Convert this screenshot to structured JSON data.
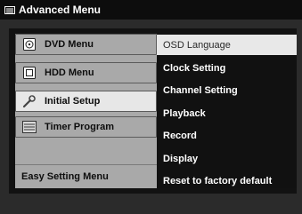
{
  "window": {
    "title": "Advanced Menu"
  },
  "left_menu": {
    "items": [
      {
        "label": "DVD Menu",
        "icon": "disc-icon"
      },
      {
        "label": "HDD Menu",
        "icon": "hdd-icon"
      },
      {
        "label": "Initial Setup",
        "icon": "wrench-icon"
      },
      {
        "label": "Timer Program",
        "icon": "list-icon"
      }
    ],
    "selected_index": 2,
    "easy_setting_label": "Easy Setting Menu"
  },
  "right_menu": {
    "items": [
      {
        "label": "OSD Language"
      },
      {
        "label": "Clock Setting"
      },
      {
        "label": "Channel Setting"
      },
      {
        "label": "Playback"
      },
      {
        "label": "Record"
      },
      {
        "label": "Display"
      },
      {
        "label": "Reset to factory default"
      }
    ],
    "selected_index": 0
  },
  "colors": {
    "background": "#2b2b2b",
    "title_bar": "#0d0d0d",
    "left_panel": "#a9a9a9",
    "right_panel": "#111111",
    "highlight": "#e8e8e8"
  }
}
